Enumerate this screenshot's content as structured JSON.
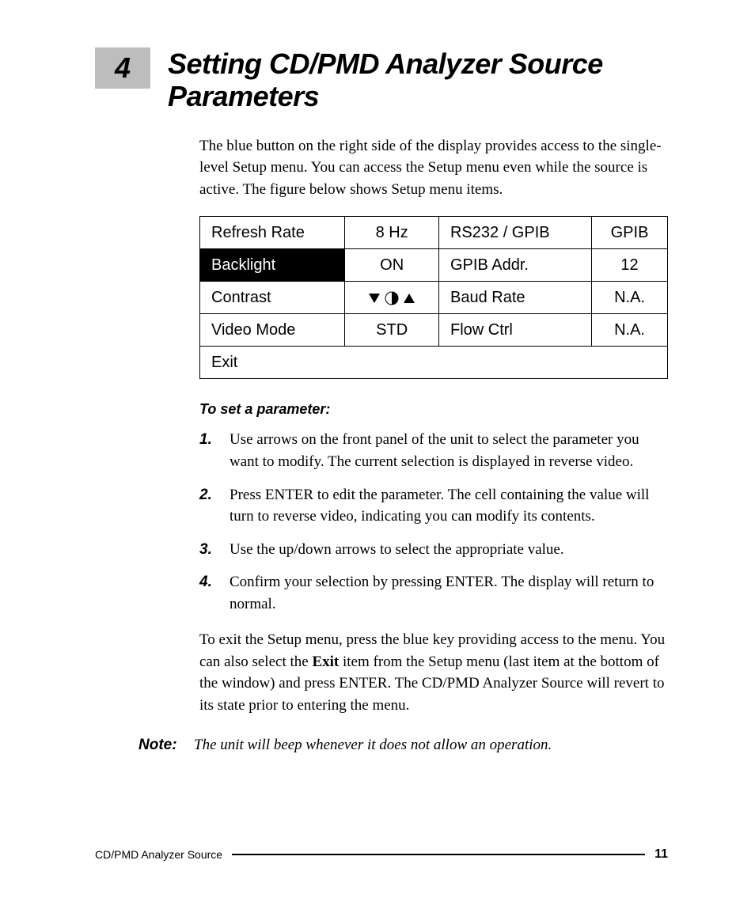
{
  "chapter": {
    "number": "4",
    "title": "Setting CD/PMD Analyzer Source Parameters"
  },
  "intro": "The blue button on the right side of the display provides access to the single-level Setup menu. You can access the Setup menu even while the source is active. The figure below shows Setup menu items.",
  "table": {
    "rows": [
      {
        "l1": "Refresh Rate",
        "v1": "8 Hz",
        "l2": "RS232 / GPIB",
        "v2": "GPIB",
        "sel": false
      },
      {
        "l1": "Backlight",
        "v1": "ON",
        "l2": "GPIB Addr.",
        "v2": "12",
        "sel": true
      },
      {
        "l1": "Contrast",
        "v1": "__CONTRAST_ICONS__",
        "l2": "Baud Rate",
        "v2": "N.A.",
        "sel": false
      },
      {
        "l1": "Video Mode",
        "v1": "STD",
        "l2": "Flow Ctrl",
        "v2": "N.A.",
        "sel": false
      }
    ],
    "exit": "Exit"
  },
  "procedure": {
    "heading": "To set a parameter:",
    "steps": [
      "Use arrows on the front panel of the unit to select the parameter you want to modify. The current selection is displayed in reverse video.",
      "Press ENTER to edit the parameter. The cell containing the value will turn to reverse video, indicating you can modify its contents.",
      "Use the up/down arrows to select the appropriate value.",
      "Confirm your selection by pressing ENTER. The display will return to normal."
    ]
  },
  "exit_para": {
    "pre": "To exit the Setup menu, press the blue key providing access to the menu. You can also select the ",
    "bold": "Exit",
    "post": " item from the Setup menu (last item at the bottom of the window) and press ENTER. The CD/PMD Analyzer Source will revert to its state prior to entering the menu."
  },
  "note": {
    "label": "Note:",
    "text": "The unit will beep whenever it does not allow an operation."
  },
  "footer": {
    "title": "CD/PMD Analyzer Source",
    "page": "11"
  }
}
